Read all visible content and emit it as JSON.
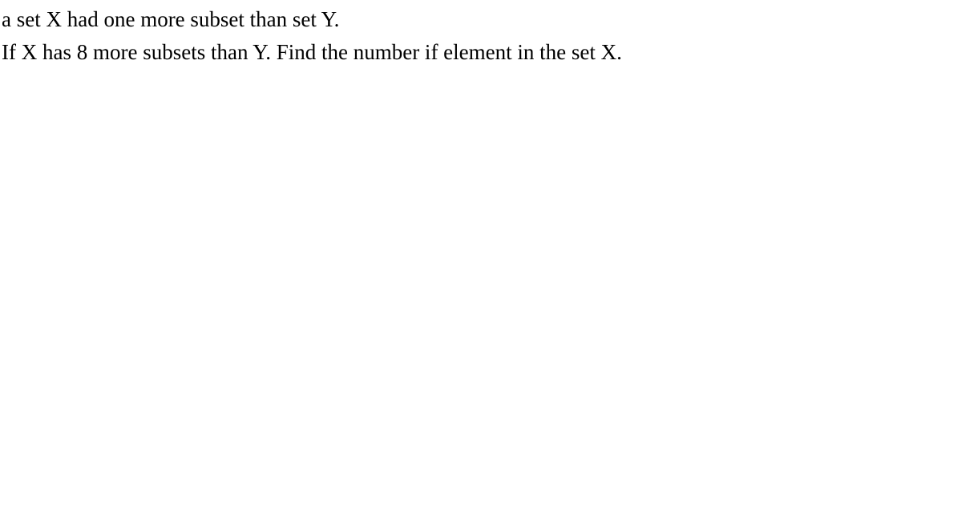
{
  "lines": {
    "line1": "a set X had one more subset than set Y.",
    "line2": "If X has 8 more subsets than Y. Find the number if element in the set X."
  }
}
